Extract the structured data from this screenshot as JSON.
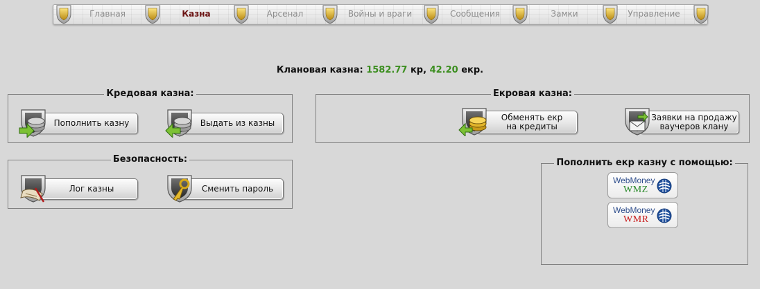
{
  "nav": {
    "items": [
      {
        "label": "Главная",
        "active": false
      },
      {
        "label": "Казна",
        "active": true
      },
      {
        "label": "Арсенал",
        "active": false
      },
      {
        "label": "Войны и враги",
        "active": false
      },
      {
        "label": "Сообщения",
        "active": false
      },
      {
        "label": "Замки",
        "active": false
      },
      {
        "label": "Управление",
        "active": false
      }
    ]
  },
  "summary": {
    "prefix": "Клановая казна:",
    "credits": "1582.77",
    "credits_unit": "кр,",
    "ekr": "42.20",
    "ekr_unit": "екр."
  },
  "credit_panel": {
    "legend": "Кредовая казна:",
    "deposit_label": "Пополнить казну",
    "withdraw_label": "Выдать из казны"
  },
  "ekr_panel": {
    "legend": "Екровая казна:",
    "exchange_label": "Обменять екр\nна кредиты",
    "voucher_label": "Заявки на продажу\nваучеров клану"
  },
  "security_panel": {
    "legend": "Безопасность:",
    "log_label": "Лог казны",
    "password_label": "Сменить пароль"
  },
  "topup_panel": {
    "legend": "Пополнить екр казну с помощью:",
    "wmz": {
      "brand": "WebMoney",
      "code": "WMZ",
      "color": "#2e8b2e"
    },
    "wmr": {
      "brand": "WebMoney",
      "code": "WMR",
      "color": "#c81e1e"
    }
  },
  "colors": {
    "amount": "#3b8e1f",
    "active_tab": "#6a1212",
    "inactive_tab": "#8c8c8c"
  },
  "icons": {
    "nav_shield": "shield-icon",
    "deposit": "coins-arrow-in-icon",
    "withdraw": "coins-arrow-out-icon",
    "exchange": "coins-exchange-icon",
    "voucher": "envelope-voucher-icon",
    "log": "scroll-log-icon",
    "password": "key-lock-icon",
    "webmoney": "webmoney-globe-icon"
  }
}
